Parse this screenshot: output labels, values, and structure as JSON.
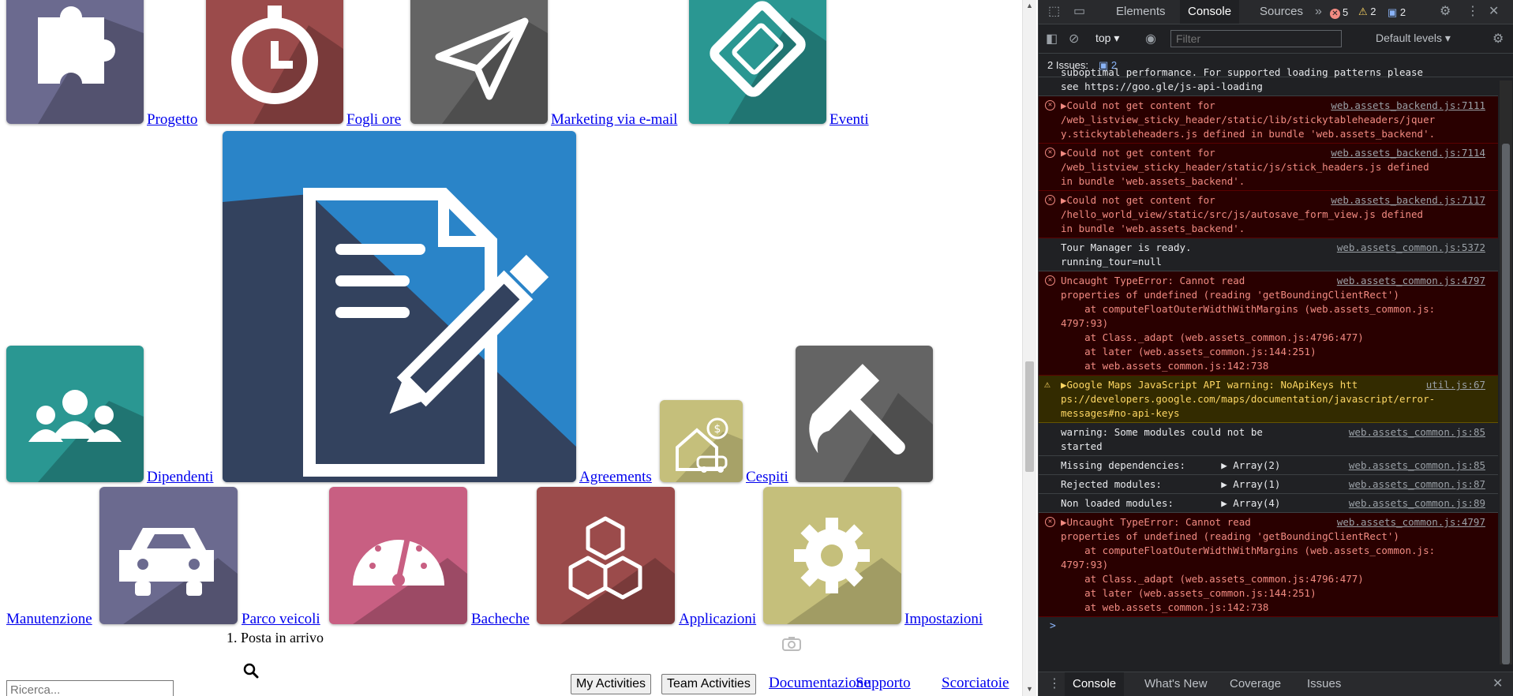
{
  "apps_row1": [
    {
      "label": "Progetto",
      "icon": "puzzle-icon",
      "color": "#6b6a8f"
    },
    {
      "label": "Fogli ore",
      "icon": "stopwatch-icon",
      "color": "#9b4b4b"
    },
    {
      "label": "Marketing via e-mail",
      "icon": "paper-plane-icon",
      "color": "#646464"
    },
    {
      "label": "Eventi",
      "icon": "ticket-icon",
      "color": "#2a9792"
    }
  ],
  "apps_row2": [
    {
      "label": "Dipendenti",
      "icon": "users-icon",
      "color": "#2a9792"
    },
    {
      "label": "Agreements",
      "icon": "document-sign-icon",
      "color": "#2a84c8"
    },
    {
      "label": "Cespiti",
      "icon": "house-car-dollar-icon",
      "color": "#c5bf7b"
    },
    {
      "label": "",
      "icon": "hammer-icon",
      "color": "#646464"
    }
  ],
  "apps_row3": [
    {
      "label": "Manutenzione",
      "icon": "",
      "color": ""
    },
    {
      "label": "Parco veicoli",
      "icon": "car-icon",
      "color": "#6b6a8f"
    },
    {
      "label": "Bacheche",
      "icon": "gauge-icon",
      "color": "#c85f82"
    },
    {
      "label": "Applicazioni",
      "icon": "cubes-icon",
      "color": "#9b4b4b"
    },
    {
      "label": "Impostazioni",
      "icon": "gear-icon",
      "color": "#c5bf7b"
    }
  ],
  "list_item": "Posta in arrivo",
  "search_placeholder": "Ricerca...",
  "buttons": {
    "my_activities": "My Activities",
    "team_activities": "Team Activities"
  },
  "links": {
    "doc": "Documentazione",
    "support": "Supporto",
    "shortcuts": "Scorciatoie"
  },
  "devtools": {
    "tabs": [
      "Elements",
      "Console",
      "Sources"
    ],
    "active_tab": "Console",
    "errors": "5",
    "warnings": "2",
    "messages": "2",
    "context": "top",
    "filter_placeholder": "Filter",
    "levels": "Default levels",
    "issues_label": "2 Issues:",
    "issues_count": "2",
    "bottom_tabs": [
      "Console",
      "What's New",
      "Coverage",
      "Issues"
    ],
    "logs": [
      {
        "type": "info",
        "text": "suboptimal performance. For supported loading patterns please\nsee https://goo.gle/js-api-loading",
        "src": ""
      },
      {
        "type": "err",
        "text": "▶Could not get content for\n/web_listview_sticky_header/static/lib/stickytableheaders/jquer\ny.stickytableheaders.js defined in bundle 'web.assets_backend'.",
        "src": "web.assets_backend.js:7111"
      },
      {
        "type": "err",
        "text": "▶Could not get content for\n/web_listview_sticky_header/static/js/stick_headers.js defined\nin bundle 'web.assets_backend'.",
        "src": "web.assets_backend.js:7114"
      },
      {
        "type": "err",
        "text": "▶Could not get content for\n/hello_world_view/static/src/js/autosave_form_view.js defined\nin bundle 'web.assets_backend'.",
        "src": "web.assets_backend.js:7117"
      },
      {
        "type": "info",
        "text": "Tour Manager is ready.\nrunning_tour=null",
        "src": "web.assets_common.js:5372"
      },
      {
        "type": "err",
        "text": "Uncaught TypeError: Cannot read\nproperties of undefined (reading 'getBoundingClientRect')\n    at computeFloatOuterWidthWithMargins (web.assets_common.js:\n4797:93)\n    at Class._adapt (web.assets_common.js:4796:477)\n    at later (web.assets_common.js:144:251)\n    at web.assets_common.js:142:738",
        "src": "web.assets_common.js:4797"
      },
      {
        "type": "warn",
        "text": "▶Google Maps JavaScript API warning: NoApiKeys htt\nps://developers.google.com/maps/documentation/javascript/error-\nmessages#no-api-keys",
        "src": "util.js:67"
      },
      {
        "type": "info",
        "text": "warning: Some modules could not be\nstarted",
        "src": "web.assets_common.js:85"
      },
      {
        "type": "info",
        "text": "Missing dependencies:      ▶ Array(2)",
        "src": "web.assets_common.js:85"
      },
      {
        "type": "info",
        "text": "Rejected modules:          ▶ Array(1)",
        "src": "web.assets_common.js:87"
      },
      {
        "type": "info",
        "text": "Non loaded modules:        ▶ Array(4)",
        "src": "web.assets_common.js:89"
      },
      {
        "type": "err",
        "text": "▶Uncaught TypeError: Cannot read\nproperties of undefined (reading 'getBoundingClientRect')\n    at computeFloatOuterWidthWithMargins (web.assets_common.js:\n4797:93)\n    at Class._adapt (web.assets_common.js:4796:477)\n    at later (web.assets_common.js:144:251)\n    at web.assets_common.js:142:738",
        "src": "web.assets_common.js:4797"
      }
    ],
    "prompt": ">"
  }
}
